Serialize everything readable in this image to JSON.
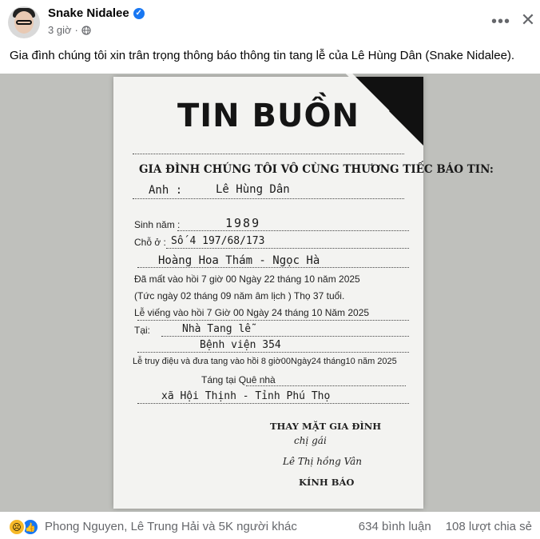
{
  "post": {
    "author": "Snake Nidalee",
    "time": "3 giờ",
    "caption": "Gia đình chúng tôi xin trân trọng thông báo thông tin tang lễ của Lê Hùng Dân (Snake Nidalee).",
    "more_icon": "more-horizontal-icon",
    "close_icon": "close-icon",
    "privacy_icon": "globe-icon"
  },
  "notice": {
    "title": "TIN BUỒN",
    "heading": "GIA ĐÌNH CHÚNG TÔI VÔ CÙNG THƯƠNG TIẾC BÁO TIN:",
    "anh_label": "Anh :",
    "name": "Lê Hùng Dân",
    "sinh_nam_label": "Sinh năm :",
    "birth_year": "1989",
    "cho_o_label": "Chỗ ở :",
    "address_1": "Số 4  197/68/173",
    "address_2": "Hoàng Hoa Thám - Ngọc Hà",
    "death_line": "Đã mất vào hồi  7  giờ 00 Ngày 22  tháng  10  năm 2025",
    "lunar_line": "(Tức ngày 02 tháng 09 năm âm lịch          ) Thọ 37  tuổi.",
    "viewing_line": "Lễ viếng  vào hồi  7  Giờ 00  Ngày 24 tháng  10  Năm 2025",
    "tai_label": "Tại:",
    "place_1": "Nhà Tang lễ",
    "place_2": "Bệnh viện 354",
    "funeral_line": "Lễ truy điệu và đưa tang vào hồi 8 giờ00Ngày24 tháng10 năm 2025",
    "burial_line": "Táng tại Quê nhà",
    "burial_place": "xã Hội Thịnh - Tỉnh Phú Thọ",
    "sign_1": "THAY MẶT GIA ĐÌNH",
    "sign_2": "chị gái",
    "sign_3": "Lê Thị hồng Vân",
    "sign_4": "KÍNH BÁO"
  },
  "footer": {
    "reactions": "Phong Nguyen, Lê Trung Hải và 5K người khác",
    "comments": "634 bình luận",
    "shares": "108 lượt chia sẻ",
    "reaction_icons": [
      "sad-reaction-icon",
      "like-reaction-icon"
    ]
  },
  "colors": {
    "accent": "#1877f2",
    "secondary_text": "#65676b"
  }
}
